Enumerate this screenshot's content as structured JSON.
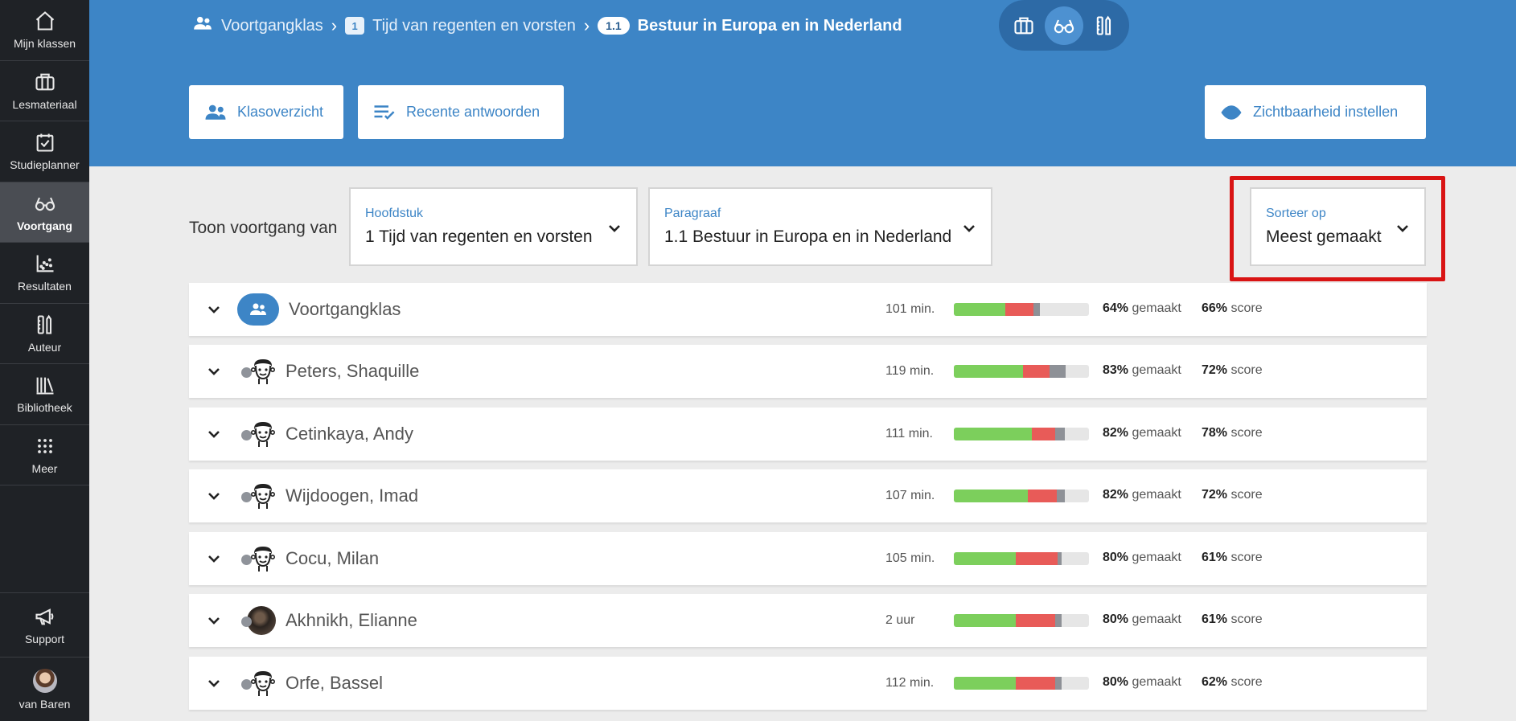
{
  "sidebar": {
    "items": [
      {
        "label": "Mijn klassen",
        "icon": "home-icon"
      },
      {
        "label": "Lesmateriaal",
        "icon": "briefcase-icon"
      },
      {
        "label": "Studieplanner",
        "icon": "calendar-check-icon"
      },
      {
        "label": "Voortgang",
        "icon": "glasses-icon",
        "active": true
      },
      {
        "label": "Resultaten",
        "icon": "scatter-chart-icon"
      },
      {
        "label": "Auteur",
        "icon": "pencil-ruler-icon"
      },
      {
        "label": "Bibliotheek",
        "icon": "books-icon"
      },
      {
        "label": "Meer",
        "icon": "grid-icon"
      }
    ],
    "support": "Support",
    "user": "van Baren"
  },
  "breadcrumb": {
    "class": "Voortgangklas",
    "chapter_num": "1",
    "chapter": "Tijd van regenten en vorsten",
    "section_num": "1.1",
    "section": "Bestuur in Europa en in Nederland"
  },
  "header": {
    "klasoverzicht": "Klasoverzicht",
    "recente": "Recente antwoorden",
    "zichtbaarheid": "Zichtbaarheid instellen"
  },
  "filters": {
    "toon_label": "Toon voortgang van",
    "hoofdstuk_caption": "Hoofdstuk",
    "hoofdstuk_value": "1 Tijd van regenten en vorsten",
    "paragraaf_caption": "Paragraaf",
    "paragraaf_value": "1.1 Bestuur in Europa en in Nederland",
    "sort_caption": "Sorteer op",
    "sort_value": "Meest gemaakt"
  },
  "labels": {
    "made_suffix": "gemaakt",
    "score_suffix": "score"
  },
  "rows": [
    {
      "name": "Voortgangklas",
      "time": "101 min.",
      "made": "64%",
      "score": "66%",
      "green": 0.38,
      "red": 0.21,
      "gray": 0.05
    },
    {
      "name": "Peters, Shaquille",
      "time": "119 min.",
      "made": "83%",
      "score": "72%",
      "green": 0.51,
      "red": 0.2,
      "gray": 0.12
    },
    {
      "name": "Cetinkaya, Andy",
      "time": "111 min.",
      "made": "82%",
      "score": "78%",
      "green": 0.58,
      "red": 0.17,
      "gray": 0.07
    },
    {
      "name": "Wijdoogen, Imad",
      "time": "107 min.",
      "made": "82%",
      "score": "72%",
      "green": 0.55,
      "red": 0.21,
      "gray": 0.06
    },
    {
      "name": "Cocu, Milan",
      "time": "105 min.",
      "made": "80%",
      "score": "61%",
      "green": 0.46,
      "red": 0.31,
      "gray": 0.03
    },
    {
      "name": "Akhnikh, Elianne",
      "time": "2 uur",
      "made": "80%",
      "score": "61%",
      "green": 0.46,
      "red": 0.29,
      "gray": 0.05
    },
    {
      "name": "Orfe, Bassel",
      "time": "112 min.",
      "made": "80%",
      "score": "62%",
      "green": 0.46,
      "red": 0.29,
      "gray": 0.05
    }
  ]
}
